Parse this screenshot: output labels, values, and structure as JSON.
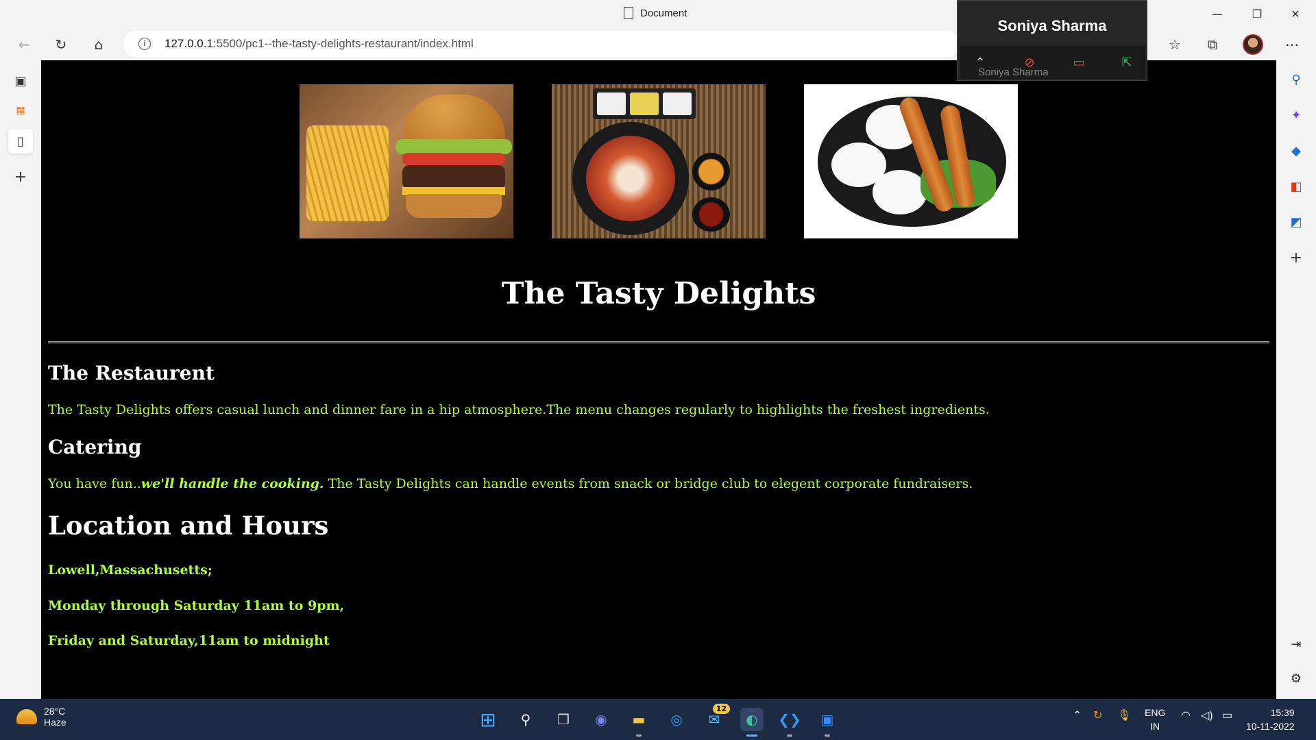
{
  "window": {
    "title": "Document",
    "controls": {
      "minimize": "—",
      "restore": "❐",
      "close": "✕"
    }
  },
  "browser": {
    "url_host": "127.0.0.1",
    "url_path": ":5500/pc1--the-tasty-delights-restaurant/index.html",
    "icons": [
      "back-icon",
      "refresh-icon",
      "home-icon",
      "info-icon",
      "favorites-icon",
      "collections-icon",
      "profile-avatar",
      "more-icon"
    ]
  },
  "page": {
    "images": [
      "burger-and-fries",
      "skillet-stew-meal",
      "sausage-platter"
    ],
    "title": "The Tasty Delights",
    "restaurant_heading": "The Restaurent",
    "restaurant_text": "The Tasty Delights offers casual lunch and dinner fare in a hip atmosphere.The menu changes regularly to highlights the freshest ingredients.",
    "catering_heading": "Catering",
    "catering_text_1": "You have fun..",
    "catering_text_em": "we'll handle the cooking.",
    "catering_text_2": " The Tasty Delights can handle events from snack or bridge club to elegent corporate fundraisers.",
    "location_heading": "Location and Hours",
    "location_line": "Lowell,Massachusetts;",
    "hours_line_1": "Monday through Saturday 11am to 9pm,",
    "hours_line_2": "Friday and Saturday,11am to midnight",
    "colors": {
      "background": "#000000",
      "text_green": "#adff2f",
      "heading": "#ffffff"
    }
  },
  "zoom_overlay": {
    "name": "Soniya Sharma",
    "sub_name": "Soniya Sharma"
  },
  "taskbar": {
    "temperature": "28°C",
    "condition": "Haze",
    "mail_badge": "12",
    "lang_1": "ENG",
    "lang_2": "IN",
    "time": "15:39",
    "date": "10-11-2022"
  }
}
